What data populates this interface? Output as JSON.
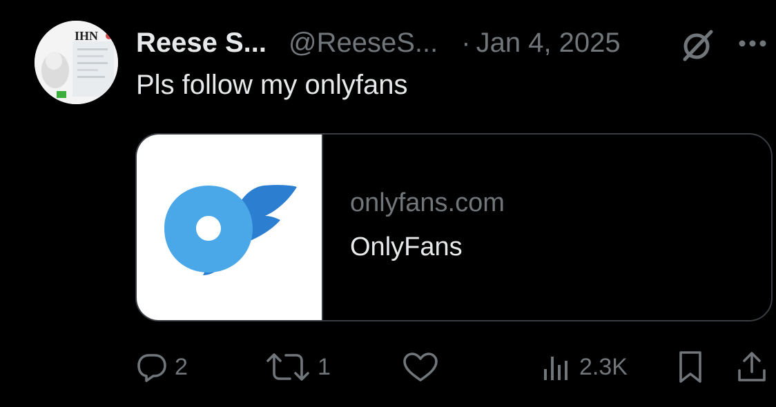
{
  "tweet": {
    "author": {
      "display_name": "Reese S...",
      "handle": "@ReeseS...",
      "avatar_icon": "profile-avatar",
      "avatar_text": "IHN"
    },
    "separator": "·",
    "date": "Jan 4, 2025",
    "header_icons": [
      "grok-icon",
      "more-icon"
    ],
    "text": "Pls follow my onlyfans",
    "card": {
      "thumbnail_icon": "onlyfans-logo",
      "domain": "onlyfans.com",
      "title": "OnlyFans"
    },
    "actions": {
      "reply": {
        "icon": "reply-icon",
        "count": "2"
      },
      "retweet": {
        "icon": "retweet-icon",
        "count": "1"
      },
      "like": {
        "icon": "heart-icon",
        "count": ""
      },
      "views": {
        "icon": "views-icon",
        "count": "2.3K"
      },
      "bookmark": {
        "icon": "bookmark-icon"
      },
      "share": {
        "icon": "share-icon"
      }
    }
  },
  "colors": {
    "background": "#000000",
    "primary_text": "#e7e9ea",
    "secondary_text": "#71767b",
    "card_border": "#3a3d41",
    "logo_light_blue": "#4aa8e8",
    "logo_dark_blue": "#2c7fd0"
  }
}
